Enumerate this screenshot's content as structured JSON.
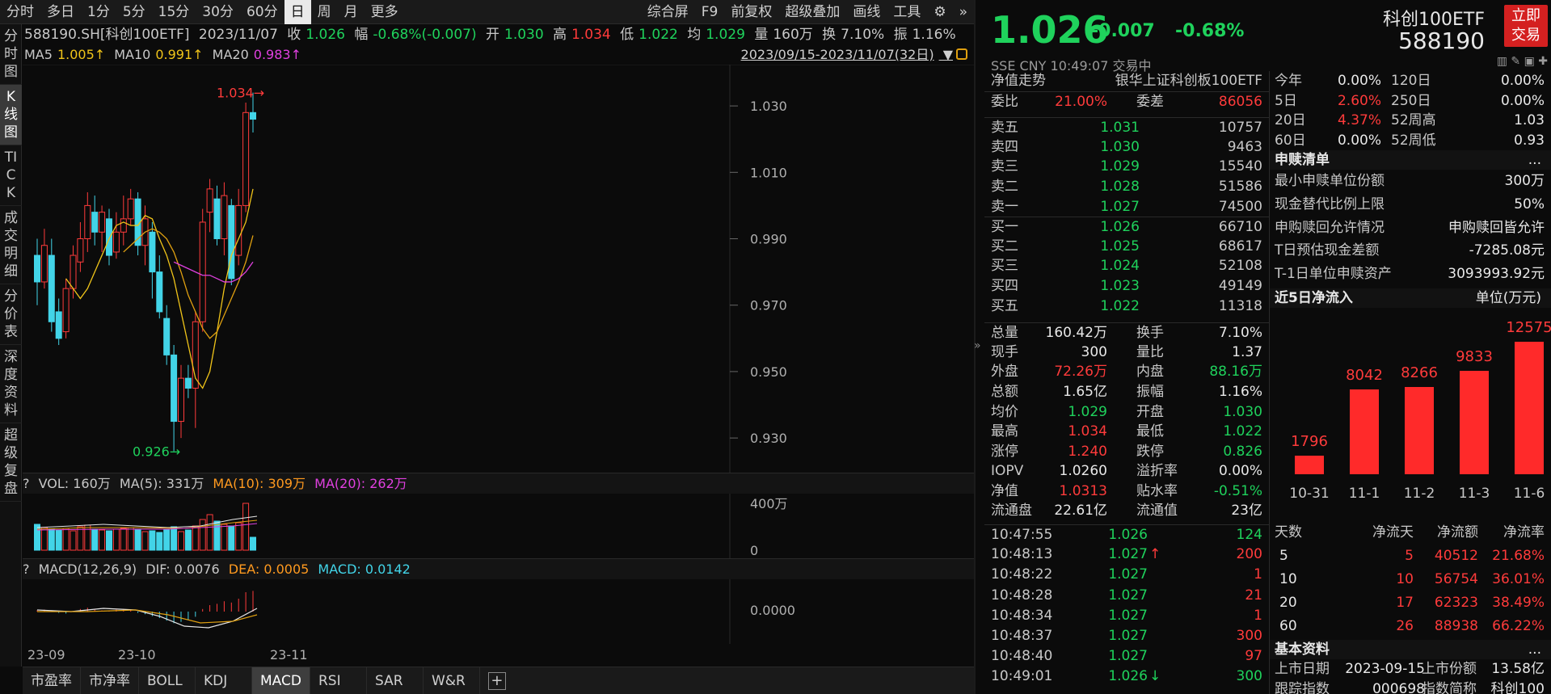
{
  "toolbar": {
    "left": [
      "分时",
      "多日",
      "1分",
      "5分",
      "15分",
      "30分",
      "60分",
      "日",
      "周",
      "月",
      "更多"
    ],
    "active": "日",
    "right": [
      "综合屏",
      "F9",
      "前复权",
      "超级叠加",
      "画线",
      "工具"
    ]
  },
  "vtabs": [
    "分时图",
    "K线图",
    "TICK",
    "成交明细",
    "分价表",
    "深度资料",
    "超级复盘"
  ],
  "vtab_active": "K线图",
  "info": {
    "code": "588190.SH[科创100ETF]",
    "date": "2023/11/07",
    "close_l": "收",
    "close": "1.026",
    "amp_l": "幅",
    "amp": "-0.68%(-0.007)",
    "open_l": "开",
    "open": "1.030",
    "high_l": "高",
    "high": "1.034",
    "low_l": "低",
    "low": "1.022",
    "avg_l": "均",
    "avg": "1.029",
    "vol_l": "量",
    "vol": "160万",
    "turn_l": "换",
    "turn": "7.10%",
    "zhen_l": "振",
    "zhen": "1.16%"
  },
  "ma": {
    "ma5_l": "MA5",
    "ma5": "1.005↑",
    "ma10_l": "MA10",
    "ma10": "0.991↑",
    "ma20_l": "MA20",
    "ma20": "0.983↑",
    "range": "2023/09/15-2023/11/07(32日)"
  },
  "yaxis": [
    "1.030",
    "1.010",
    "0.990",
    "0.970",
    "0.950",
    "0.930"
  ],
  "marks": {
    "high": "1.034",
    "low": "0.926"
  },
  "vol_head": {
    "q": "?",
    "vol": "VOL: 160万",
    "ma5": "MA(5): 331万",
    "ma10": "MA(10): 309万",
    "ma20": "MA(20): 262万"
  },
  "vol_axis": [
    "400万",
    "0"
  ],
  "macd_head": {
    "q": "?",
    "name": "MACD(12,26,9)",
    "dif": "DIF: 0.0076",
    "dea": "DEA: 0.0005",
    "macd": "MACD: 0.0142"
  },
  "macd_axis": "0.0000",
  "xaxis": [
    "23-09",
    "23-10",
    "23-11"
  ],
  "bottom_tabs": [
    "市盈率",
    "市净率",
    "BOLL",
    "KDJ",
    "MACD",
    "RSI",
    "SAR",
    "W&R"
  ],
  "bottom_active": "MACD",
  "quote": {
    "price": "1.026",
    "chg": "-0.007",
    "pct": "-0.68%",
    "exch": "SSE  CNY   10:49:07  交易中",
    "name": "科创100ETF",
    "code": "588190",
    "trade": "立即交易"
  },
  "jz": {
    "label": "净值走势",
    "name": "银华上证科创板100ETF"
  },
  "wb": {
    "wb_l": "委比",
    "wb": "21.00%",
    "wc_l": "委差",
    "wc": "86056"
  },
  "asks": [
    [
      "卖五",
      "1.031",
      "10757"
    ],
    [
      "卖四",
      "1.030",
      "9463"
    ],
    [
      "卖三",
      "1.029",
      "15540"
    ],
    [
      "卖二",
      "1.028",
      "51586"
    ],
    [
      "卖一",
      "1.027",
      "74500"
    ]
  ],
  "bids": [
    [
      "买一",
      "1.026",
      "66710"
    ],
    [
      "买二",
      "1.025",
      "68617"
    ],
    [
      "买三",
      "1.024",
      "52108"
    ],
    [
      "买四",
      "1.023",
      "49149"
    ],
    [
      "买五",
      "1.022",
      "11318"
    ]
  ],
  "stats": [
    [
      "总量",
      "160.42万",
      "换手",
      "7.10%"
    ],
    [
      "现手",
      "300",
      "量比",
      "1.37"
    ],
    [
      "外盘",
      "72.26万",
      "内盘",
      "88.16万"
    ],
    [
      "总额",
      "1.65亿",
      "振幅",
      "1.16%"
    ],
    [
      "均价",
      "1.029",
      "开盘",
      "1.030"
    ],
    [
      "最高",
      "1.034",
      "最低",
      "1.022"
    ],
    [
      "涨停",
      "1.240",
      "跌停",
      "0.826"
    ],
    [
      "IOPV",
      "1.0260",
      "溢折率",
      "0.00%"
    ],
    [
      "净值",
      "1.0313",
      "贴水率",
      "-0.51%"
    ],
    [
      "流通盘",
      "22.61亿",
      "流通值",
      "23亿"
    ]
  ],
  "ticks": [
    [
      "10:47:55",
      "1.026",
      "",
      "124"
    ],
    [
      "10:48:13",
      "1.027",
      "up",
      "200"
    ],
    [
      "10:48:22",
      "1.027",
      "",
      "1"
    ],
    [
      "10:48:28",
      "1.027",
      "",
      "21"
    ],
    [
      "10:48:34",
      "1.027",
      "",
      "1"
    ],
    [
      "10:48:37",
      "1.027",
      "",
      "300"
    ],
    [
      "10:48:40",
      "1.027",
      "",
      "97"
    ],
    [
      "10:49:01",
      "1.026",
      "down",
      "300"
    ]
  ],
  "perf": [
    [
      "今年",
      "0.00%",
      "120日",
      "0.00%"
    ],
    [
      "5日",
      "2.60%",
      "250日",
      "0.00%"
    ],
    [
      "20日",
      "4.37%",
      "52周高",
      "1.03"
    ],
    [
      "60日",
      "0.00%",
      "52周低",
      "0.93"
    ]
  ],
  "sg": {
    "title": "申赎清单",
    "more": "...",
    "rows": [
      [
        "最小申赎单位份额",
        "300万"
      ],
      [
        "现金替代比例上限",
        "50%"
      ],
      [
        "申购赎回允许情况",
        "申购赎回皆允许"
      ],
      [
        "T日预估现金差额",
        "-7285.08元"
      ],
      [
        "T-1日单位申赎资产",
        "3093993.92元"
      ]
    ]
  },
  "flow": {
    "title": "近5日净流入",
    "unit": "单位(万元)"
  },
  "chart_data": {
    "type": "bar",
    "categories": [
      "10-31",
      "11-1",
      "11-2",
      "11-3",
      "11-6"
    ],
    "values": [
      1796,
      8042,
      8266,
      9833,
      12575
    ],
    "title": "近5日净流入",
    "ylabel": "单位(万元)"
  },
  "flowtbl": {
    "head": [
      "天数",
      "净流天",
      "净流额",
      "净流率"
    ],
    "rows": [
      [
        "5",
        "5",
        "40512",
        "21.68%"
      ],
      [
        "10",
        "10",
        "56754",
        "36.01%"
      ],
      [
        "20",
        "17",
        "62323",
        "38.49%"
      ],
      [
        "60",
        "26",
        "88938",
        "66.22%"
      ]
    ]
  },
  "basic": {
    "title": "基本资料",
    "more": "...",
    "r1": [
      "上市日期",
      "2023-09-15",
      "上市份额",
      "13.58亿"
    ],
    "r2": [
      "跟踪指数",
      "000698",
      "指数简称",
      "科创100"
    ]
  },
  "colors": {
    "up": "#ff3b3b",
    "down": "#1fd25c",
    "ma5": "#f0c419",
    "ma10": "#e0a010",
    "ma20": "#e040e0",
    "vol": "#42d4e8"
  }
}
